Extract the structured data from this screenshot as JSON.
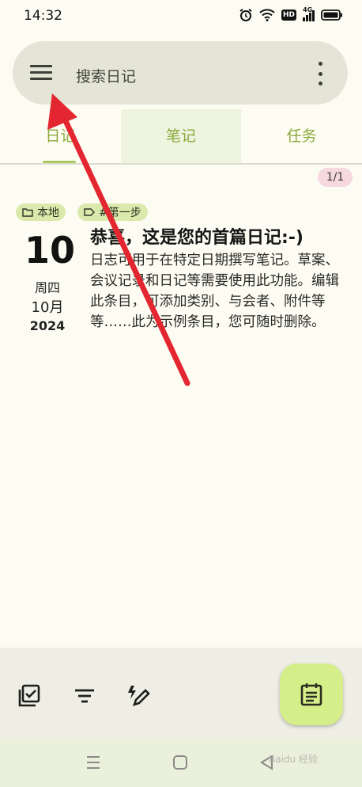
{
  "status_bar": {
    "time": "14:32",
    "hd": "HD",
    "network": "4G"
  },
  "search": {
    "placeholder": "搜索日记"
  },
  "tabs": [
    {
      "label": "日记",
      "selected": true
    },
    {
      "label": "笔记",
      "selected": false
    },
    {
      "label": "任务",
      "selected": false
    }
  ],
  "page_indicator": "1/1",
  "entry": {
    "chips": {
      "folder": "本地",
      "tag": "#第一步"
    },
    "day": "10",
    "weekday": "周四",
    "month": "10月",
    "year": "2024",
    "title": "恭喜，这是您的首篇日记:-)",
    "body": "日志可用于在特定日期撰写笔记。草案、会议记录和日记等需要使用此功能。编辑此条目，可添加类别、与会者、附件等等……此为示例条目，您可随时删除。"
  },
  "watermark": "Baidu 经验",
  "colors": {
    "accent": "#8caa3e",
    "chip": "#dbe9ad",
    "fab": "#d4ef8a",
    "annotation_arrow": "#e3262f"
  },
  "icons": {
    "bottom_bar": [
      "select-all-icon",
      "filter-icon",
      "edit-auto-icon"
    ],
    "fab": "calendar-icon",
    "nav": [
      "recents-icon",
      "home-icon",
      "back-icon"
    ]
  }
}
